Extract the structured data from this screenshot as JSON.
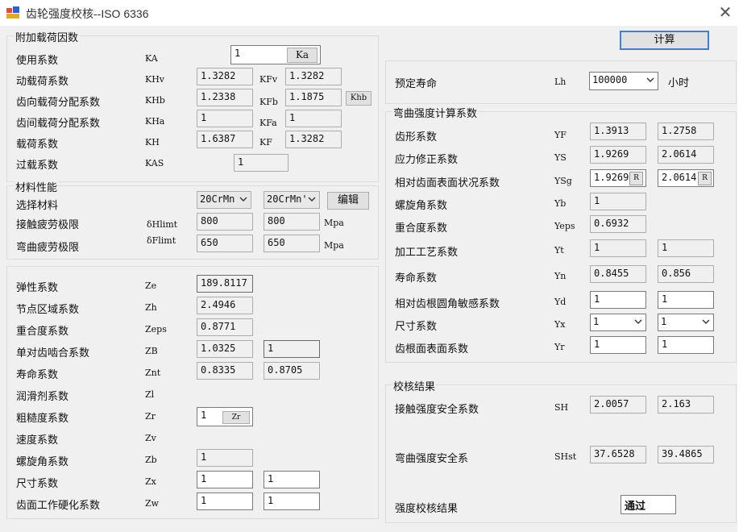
{
  "window": {
    "title": "齿轮强度校核--ISO 6336"
  },
  "calc_button": "计算",
  "load_factors": {
    "title": "附加载荷因数",
    "use": {
      "label": "使用系数",
      "sym": "KA",
      "value": "1",
      "btn": "Ka"
    },
    "dynamic": {
      "label": "动载荷系数",
      "sym": "KHv",
      "value": "1.3282",
      "sym2": "KFv",
      "value2": "1.3282"
    },
    "face": {
      "label": "齿向载荷分配系数",
      "sym": "KHb",
      "value": "1.2338",
      "sym2": "KFb",
      "value2": "1.1875",
      "btn": "Khb"
    },
    "transverse": {
      "label": "齿间载荷分配系数",
      "sym": "KHa",
      "value": "1",
      "sym2": "KFa",
      "value2": "1"
    },
    "load": {
      "label": "载荷系数",
      "sym": "KH",
      "value": "1.6387",
      "sym2": "KF",
      "value2": "1.3282"
    },
    "overload": {
      "label": "过载系数",
      "sym": "KAS",
      "value": "1"
    }
  },
  "material": {
    "title": "材料性能",
    "select": {
      "label": "选择材料",
      "mat1": "20CrMn",
      "mat2": "20CrMn'",
      "btn": "编辑"
    },
    "contact": {
      "label": "接触疲劳极限",
      "sym": "δHlimt",
      "value": "800",
      "value2": "800",
      "unit": "Mpa"
    },
    "bending": {
      "label": "弯曲疲劳极限",
      "sym": "δFlimt",
      "value": "650",
      "value2": "650",
      "unit": "Mpa"
    }
  },
  "contact_factors": [
    {
      "label": "弹性系数",
      "sym": "Ze",
      "value": "189.8117",
      "value2": ""
    },
    {
      "label": "节点区域系数",
      "sym": "Zh",
      "value": "2.4946",
      "value2": ""
    },
    {
      "label": "重合度系数",
      "sym": "Zeps",
      "value": "0.8771",
      "value2": ""
    },
    {
      "label": "单对齿啮合系数",
      "sym": "ZB",
      "value": "1.0325",
      "value2": "1"
    },
    {
      "label": "寿命系数",
      "sym": "Znt",
      "value": "0.8335",
      "value2": "0.8705"
    },
    {
      "label": "润滑剂系数",
      "sym": "Zl",
      "value": "",
      "value2": ""
    },
    {
      "label": "粗糙度系数",
      "sym": "Zr",
      "value": "1",
      "value2": "",
      "btn": "Zr"
    },
    {
      "label": "速度系数",
      "sym": "Zv",
      "value": "",
      "value2": ""
    },
    {
      "label": "螺旋角系数",
      "sym": "Zb",
      "value": "1",
      "value2": ""
    },
    {
      "label": "尺寸系数",
      "sym": "Zx",
      "value": "1",
      "value2": "1"
    },
    {
      "label": "齿面工作硬化系数",
      "sym": "Zw",
      "value": "1",
      "value2": "1"
    }
  ],
  "life": {
    "label": "预定寿命",
    "sym": "Lh",
    "value": "100000",
    "unit": "小时"
  },
  "bending_factors": {
    "title": "弯曲强度计算系数",
    "rows": [
      {
        "label": "齿形系数",
        "sym": "YF",
        "value": "1.3913",
        "value2": "1.2758"
      },
      {
        "label": "应力修正系数",
        "sym": "YS",
        "value": "1.9269",
        "value2": "2.0614"
      },
      {
        "label": "相对齿面表面状况系数",
        "sym": "YSg",
        "value": "1.9269",
        "value2": "2.0614",
        "btn": "R"
      },
      {
        "label": "螺旋角系数",
        "sym": "Yb",
        "value": "1",
        "value2": ""
      },
      {
        "label": "重合度系数",
        "sym": "Yeps",
        "value": "0.6932",
        "value2": ""
      },
      {
        "label": "加工工艺系数",
        "sym": "Yt",
        "value": "1",
        "value2": "1"
      },
      {
        "label": "寿命系数",
        "sym": "Yn",
        "value": "0.8455",
        "value2": "0.856"
      },
      {
        "label": "相对齿根圆角敏感系数",
        "sym": "Yd",
        "value": "1",
        "value2": "1"
      },
      {
        "label": "尺寸系数",
        "sym": "Yx",
        "value": "1",
        "value2": "1"
      },
      {
        "label": "齿根面表面系数",
        "sym": "Yr",
        "value": "1",
        "value2": "1"
      }
    ]
  },
  "results": {
    "title": "校核结果",
    "contact_safety": {
      "label": "接触强度安全系数",
      "sym": "SH",
      "value": "2.0057",
      "value2": "2.163"
    },
    "bending_safety": {
      "label": "弯曲强度安全系",
      "sym": "SHst",
      "value": "37.6528",
      "value2": "39.4865"
    },
    "check": {
      "label": "强度校核结果",
      "value": "通过"
    }
  }
}
